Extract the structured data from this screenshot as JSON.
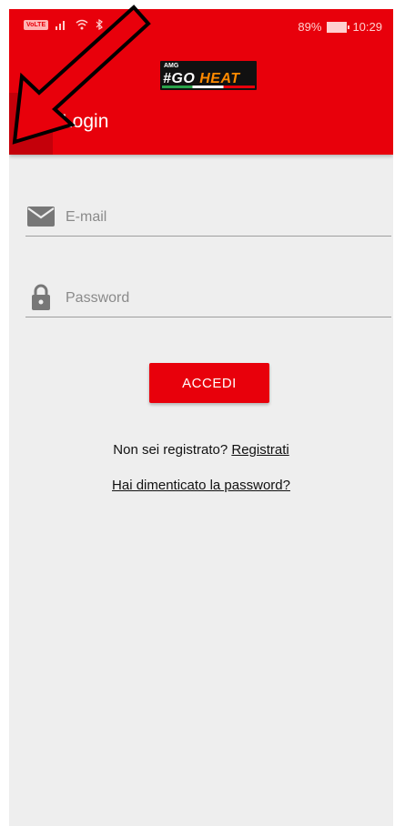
{
  "status_bar": {
    "volte": "VoLTE",
    "battery": "89%",
    "time": "10:29"
  },
  "app_bar": {
    "logo_small": "AMG",
    "logo_hash_go": "#GO ",
    "logo_heat": "HEAT",
    "title": "Login"
  },
  "form": {
    "email_placeholder": "E-mail",
    "password_placeholder": "Password",
    "submit_label": "ACCEDI"
  },
  "links": {
    "not_registered": "Non sei registrato?",
    "register": "Registrati",
    "forgot_password": "Hai dimenticato la password?"
  },
  "colors": {
    "brand_red": "#e8000b",
    "menu_highlight": "#c4000a",
    "background": "#eeeeee"
  },
  "icons": [
    "hamburger-menu-icon",
    "email-icon",
    "lock-icon",
    "signal-icon",
    "wifi-icon",
    "bluetooth-icon",
    "battery-icon"
  ]
}
